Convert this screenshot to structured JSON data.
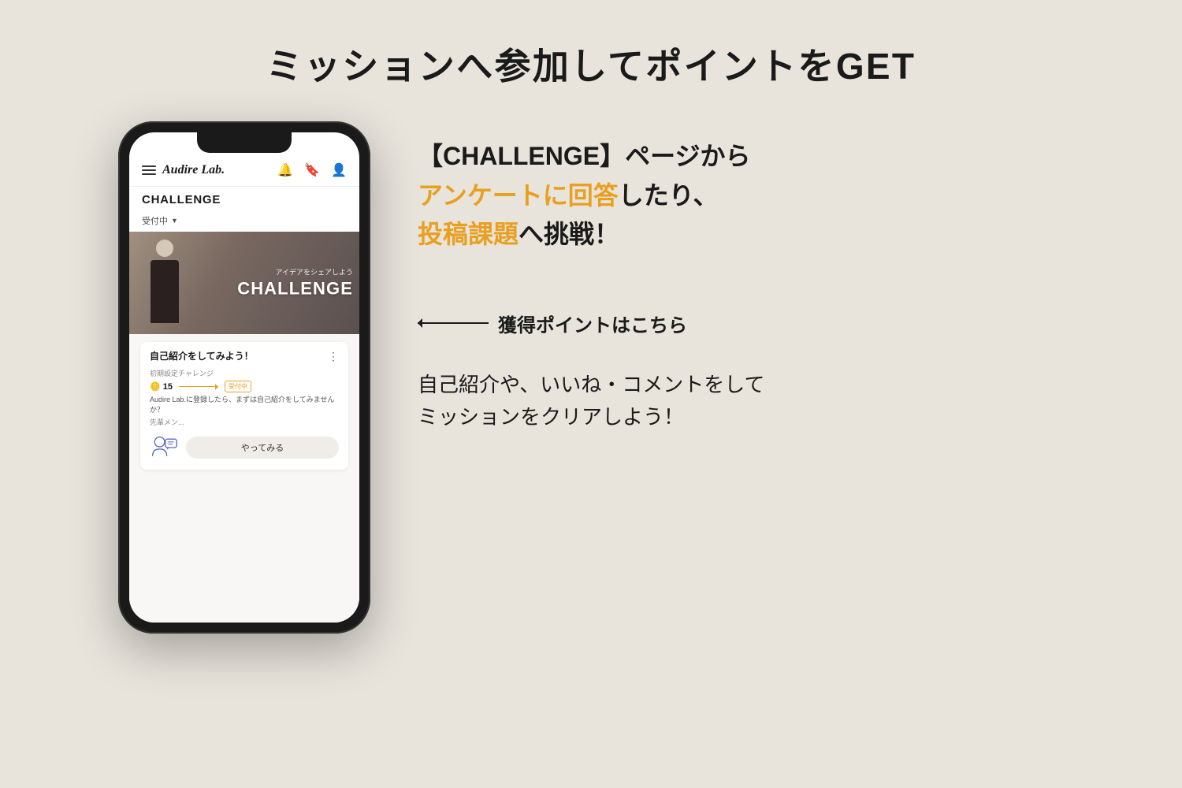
{
  "page": {
    "background_color": "#e8e4dc",
    "title": "ミッションへ参加してポイントをGET"
  },
  "phone": {
    "app_name": "Audire Lab.",
    "section_label": "CHALLENGE",
    "filter_label": "受付中",
    "filter_arrow": "▼",
    "banner_subtitle": "アイデアをシェアしよう",
    "banner_text": "CHALLENGE",
    "card_title": "自己紹介をしてみよう！",
    "card_meta": "初期設定チャレンジ",
    "card_points": "15",
    "card_status": "受付中",
    "card_description": "Audire Lab.に登録したら、まずは自己紹介をしてみませんか？",
    "card_senior": "先輩メン...",
    "card_button_label": "やってみる"
  },
  "right": {
    "line1": "【CHALLENGE】ページから",
    "line2_prefix": "アンケートに回答",
    "line2_suffix": "したり、",
    "line3_prefix": "投稿課題",
    "line3_suffix": "へ挑戦！",
    "annotation": "獲得ポイントはこちら",
    "bottom_line1": "自己紹介や、いいね・コメントをして",
    "bottom_line2": "ミッションをクリアしよう！"
  }
}
